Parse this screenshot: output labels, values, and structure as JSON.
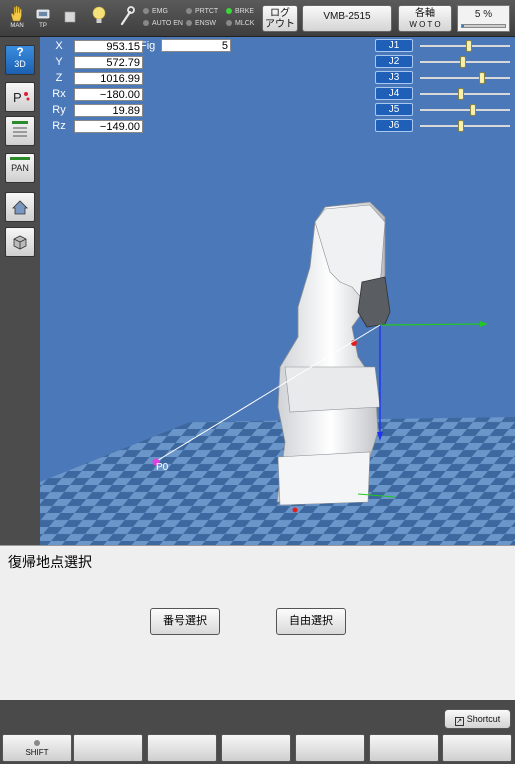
{
  "topbar": {
    "icons": [
      {
        "name": "hand-icon",
        "label": "MAN"
      },
      {
        "name": "teach-pendant-icon",
        "label": "TP"
      },
      {
        "name": "stop-icon",
        "label": ""
      },
      {
        "name": "lightbulb-icon",
        "label": ""
      },
      {
        "name": "wrench-icon",
        "label": ""
      }
    ],
    "status": {
      "emg": "EMG",
      "autoen": "AUTO EN",
      "prtct": "PRTCT",
      "ensw": "ENSW",
      "brke": "BRKE",
      "mlck": "MLCK"
    },
    "logout_line1": "ログ",
    "logout_line2": "アウト",
    "robot_model": "VMB-2515",
    "axis_line1": "各軸",
    "axis_line2": "W O T O",
    "speed": "5 %",
    "speed_fraction": 0.05
  },
  "leftbar": {
    "btn_3d": "3D",
    "btn_pan": "PAN"
  },
  "coords": [
    {
      "label": "X",
      "value": "953.15"
    },
    {
      "label": "Y",
      "value": "572.79"
    },
    {
      "label": "Z",
      "value": "1016.99"
    },
    {
      "label": "Rx",
      "value": "−180.00"
    },
    {
      "label": "Ry",
      "value": "19.89"
    },
    {
      "label": "Rz",
      "value": "−149.00"
    }
  ],
  "fig": {
    "label": "Fig",
    "value": "5"
  },
  "joints": [
    {
      "label": "J1",
      "level": 0.55
    },
    {
      "label": "J2",
      "level": 0.48
    },
    {
      "label": "J3",
      "level": 0.7
    },
    {
      "label": "J4",
      "level": 0.45
    },
    {
      "label": "J5",
      "level": 0.6
    },
    {
      "label": "J6",
      "level": 0.45
    }
  ],
  "viewport": {
    "point_label": "P0"
  },
  "panel": {
    "title": "復帰地点選択",
    "btn_number": "番号選択",
    "btn_free": "自由選択"
  },
  "footer": {
    "shortcut": "Shortcut",
    "shift": "SHIFT"
  },
  "colors": {
    "viewport_bg": "#4a78b8",
    "checker_dark": "#3d689f",
    "checker_light": "#6b96c9",
    "accent": "#1f5fb8"
  }
}
